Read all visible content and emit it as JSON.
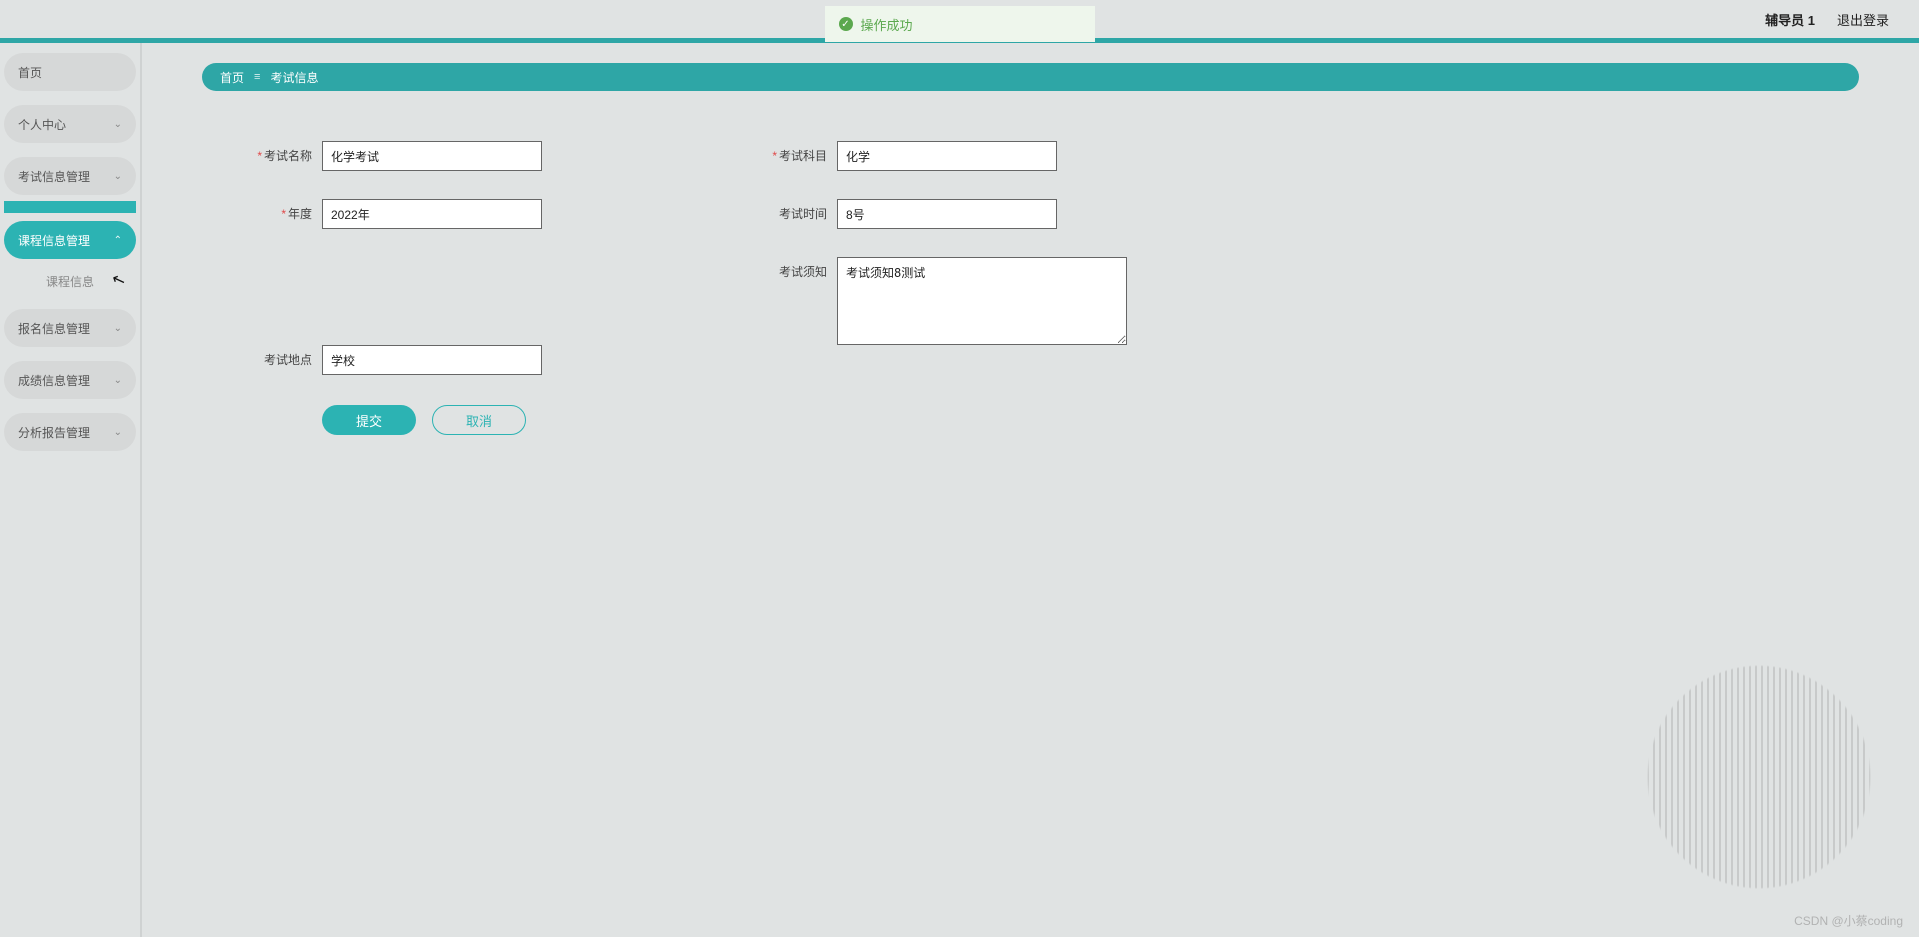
{
  "header": {
    "user_label": "辅导员 1",
    "logout_label": "退出登录"
  },
  "toast": {
    "text": "操作成功"
  },
  "sidebar": {
    "items": [
      {
        "label": "首页",
        "expandable": false
      },
      {
        "label": "个人中心",
        "expandable": true
      },
      {
        "label": "考试信息管理",
        "expandable": true
      },
      {
        "label": "课程信息管理",
        "expandable": true,
        "active": true
      },
      {
        "label": "报名信息管理",
        "expandable": true
      },
      {
        "label": "成绩信息管理",
        "expandable": true
      },
      {
        "label": "分析报告管理",
        "expandable": true
      }
    ],
    "sub_course": "课程信息"
  },
  "breadcrumb": {
    "home": "首页",
    "sep": "≡",
    "current": "考试信息"
  },
  "form": {
    "exam_name": {
      "label": "考试名称",
      "value": "化学考试",
      "required": true
    },
    "exam_subject": {
      "label": "考试科目",
      "value": "化学",
      "required": true
    },
    "year": {
      "label": "年度",
      "value": "2022年",
      "required": true
    },
    "exam_time": {
      "label": "考试时间",
      "value": "8号",
      "required": false
    },
    "exam_place": {
      "label": "考试地点",
      "value": "学校",
      "required": false
    },
    "exam_notice": {
      "label": "考试须知",
      "value": "考试须知8测试",
      "required": false
    }
  },
  "buttons": {
    "submit": "提交",
    "cancel": "取消"
  },
  "watermark": "CSDN @小蔡coding"
}
